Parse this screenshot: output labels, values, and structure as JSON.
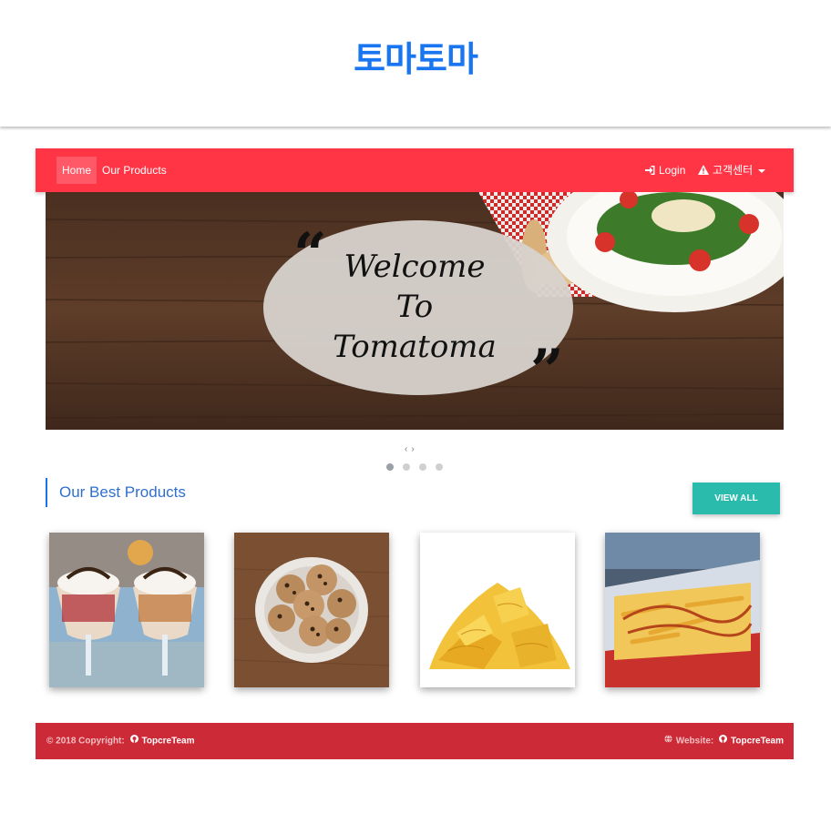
{
  "brand": {
    "logo_text": "토마토마"
  },
  "navbar": {
    "home_label": "Home",
    "products_label": "Our Products",
    "login_label": "Login",
    "customer_center_label": "고객센터"
  },
  "carousel": {
    "line1": "Welcome",
    "line2": "To",
    "line3": "Tomatoma",
    "prev_label": "‹",
    "next_label": "›",
    "indicator_count": 4,
    "active_index": 0
  },
  "best_products": {
    "title": "Our Best Products",
    "view_all_label": "VIEW ALL",
    "items": [
      {
        "image": "ice-cream-sundae"
      },
      {
        "image": "chocolate-chip-cookies"
      },
      {
        "image": "potato-chips"
      },
      {
        "image": "french-fries"
      }
    ]
  },
  "footer": {
    "copyright_prefix": "© 2018 Copyright:",
    "copyright_name": "TopcreTeam",
    "website_prefix": "Website:",
    "website_name": "TopcreTeam"
  },
  "colors": {
    "navbar": "#ff3546",
    "footer": "#cc2a37",
    "accent_blue": "#1976f0",
    "teal_button": "#2bbbad"
  }
}
